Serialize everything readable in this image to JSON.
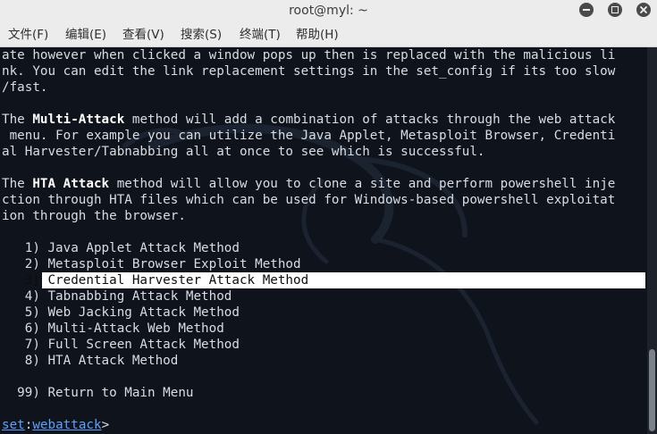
{
  "window": {
    "title": "root@myl: ~"
  },
  "menu": [
    "文件(F)",
    "编辑(E)",
    "查看(V)",
    "搜索(S)",
    "终端(T)",
    "帮助(H)"
  ],
  "terminal": {
    "lines": [
      "ate however when clicked a window pops up then is replaced with the malicious li",
      "nk. You can edit the link replacement settings in the set_config if its too slow",
      "/fast.",
      "",
      [
        "The ",
        "Multi-Attack",
        " method will add a combination of attacks through the web attack"
      ],
      " menu. For example you can utilize the Java Applet, Metasploit Browser, Credenti",
      "al Harvester/Tabnabbing all at once to see which is successful.",
      "",
      [
        "The ",
        "HTA Attack",
        " method will allow you to clone a site and perform powershell inje"
      ],
      "ction through HTA files which can be used for Windows-based powershell exploitat",
      "ion through the browser."
    ],
    "options": [
      "   1) Java Applet Attack Method",
      "   2) Metasploit Browser Exploit Method",
      "   3) Credential Harvester Attack Method",
      "   4) Tabnabbing Attack Method",
      "   5) Web Jacking Attack Method",
      "   6) Multi-Attack Web Method",
      "   7) Full Screen Attack Method",
      "   8) HTA Attack Method"
    ],
    "selected_option_index": 2,
    "return_option": "  99) Return to Main Menu",
    "prompt": {
      "prefix": "set",
      "separator": ":",
      "module": "webattack",
      "suffix": ">"
    }
  },
  "colors": {
    "titlebar": "#ececec",
    "terminal_bg": "#0f141c",
    "text": "#d9dde2",
    "highlight": "#ffffff",
    "prompt_link": "#5aa2ff"
  },
  "icons": {
    "minimize": "minimize-icon",
    "maximize": "maximize-icon",
    "close": "close-icon",
    "background": "kali-dragon-watermark"
  }
}
